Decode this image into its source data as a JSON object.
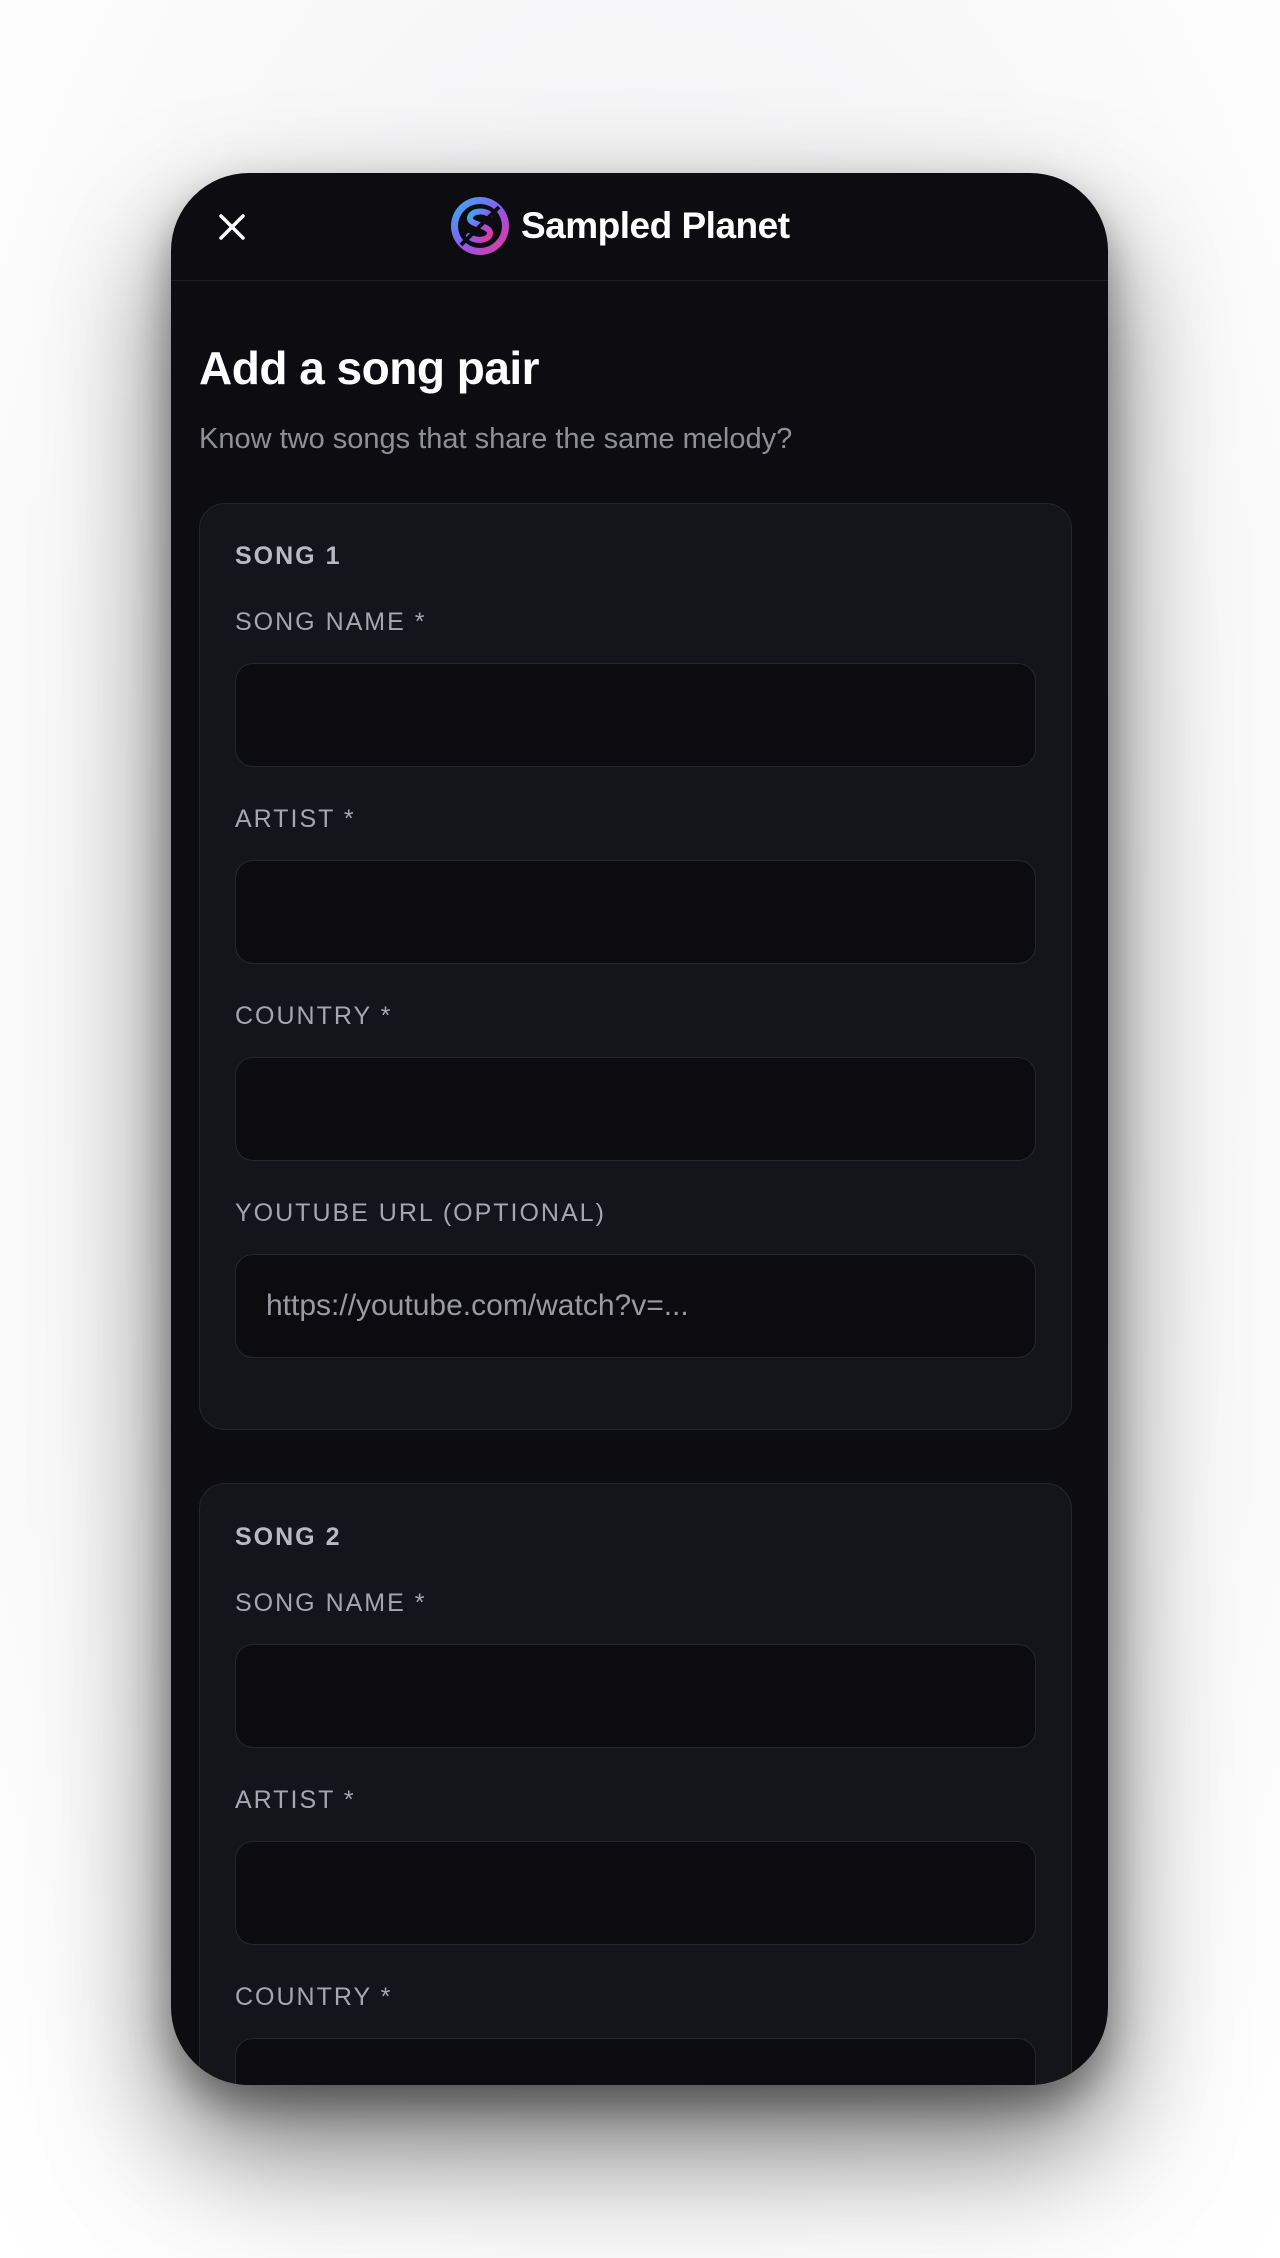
{
  "header": {
    "brand_name": "Sampled Planet",
    "close_icon": "close-icon",
    "logo_icon": "sampled-planet-logo"
  },
  "page": {
    "title": "Add a song pair",
    "subtitle": "Know two songs that share the same melody?"
  },
  "song1": {
    "title": "SONG 1",
    "song_name_label": "SONG NAME *",
    "song_name_value": "",
    "artist_label": "ARTIST *",
    "artist_value": "",
    "country_label": "COUNTRY *",
    "country_value": "",
    "youtube_label": "YOUTUBE URL (OPTIONAL)",
    "youtube_placeholder": "https://youtube.com/watch?v=..."
  },
  "song2": {
    "title": "SONG 2",
    "song_name_label": "SONG NAME *",
    "song_name_value": "",
    "artist_label": "ARTIST *",
    "artist_value": "",
    "country_label": "COUNTRY *",
    "country_value": ""
  },
  "colors": {
    "background": "#0d0d11",
    "card": "#14141b",
    "input": "#0c0c10",
    "logo_gradient_start": "#2fb8f0",
    "logo_gradient_end": "#e8338f"
  }
}
